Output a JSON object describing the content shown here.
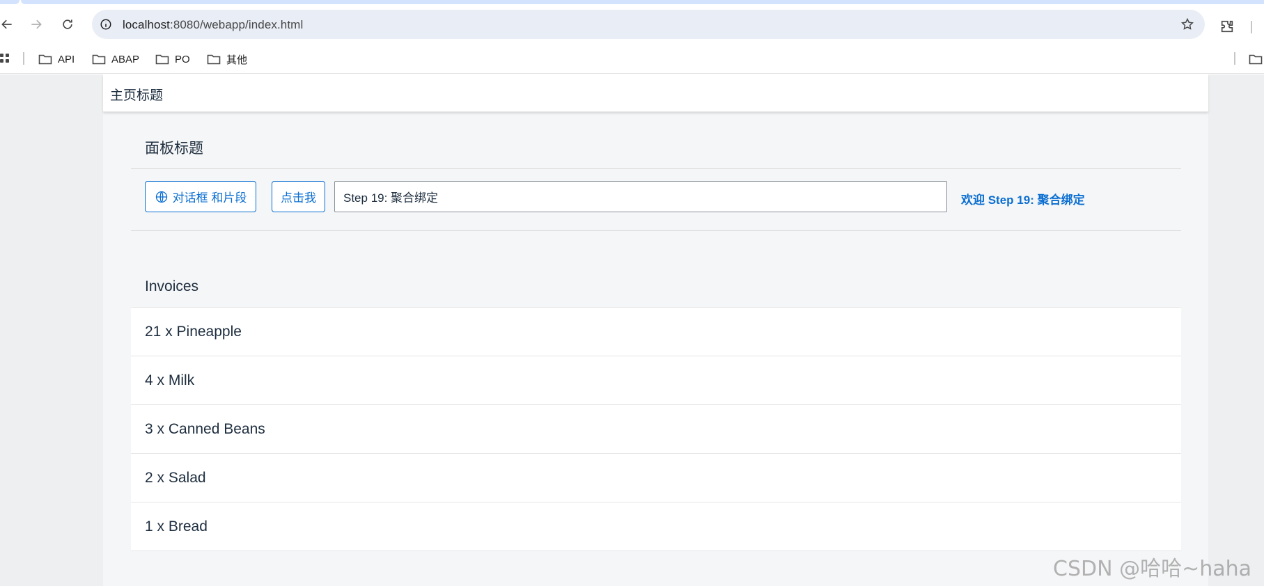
{
  "browser": {
    "url_host": "localhost",
    "url_path": ":8080/webapp/index.html",
    "bookmarks": [
      {
        "label": "API"
      },
      {
        "label": "ABAP"
      },
      {
        "label": "PO"
      },
      {
        "label": "其他"
      }
    ]
  },
  "shell": {
    "title": "主页标题"
  },
  "panel": {
    "title": "面板标题",
    "dialog_button_label": "对话框 和片段",
    "click_button_label": "点击我",
    "name_input_value": "Step 19: 聚合绑定",
    "welcome_text": "欢迎 Step 19: 聚合绑定"
  },
  "invoices": {
    "title": "Invoices",
    "items": [
      {
        "label": "21 x Pineapple"
      },
      {
        "label": "4 x Milk"
      },
      {
        "label": "3 x Canned Beans"
      },
      {
        "label": "2 x Salad"
      },
      {
        "label": "1 x Bread"
      }
    ]
  },
  "watermark": "CSDN @哈哈~haha",
  "colors": {
    "accent": "#0a6ed1",
    "shell_bg": "#f5f6f7",
    "outer_bg": "#edeff0",
    "omnibox_bg": "#e9eef6"
  }
}
